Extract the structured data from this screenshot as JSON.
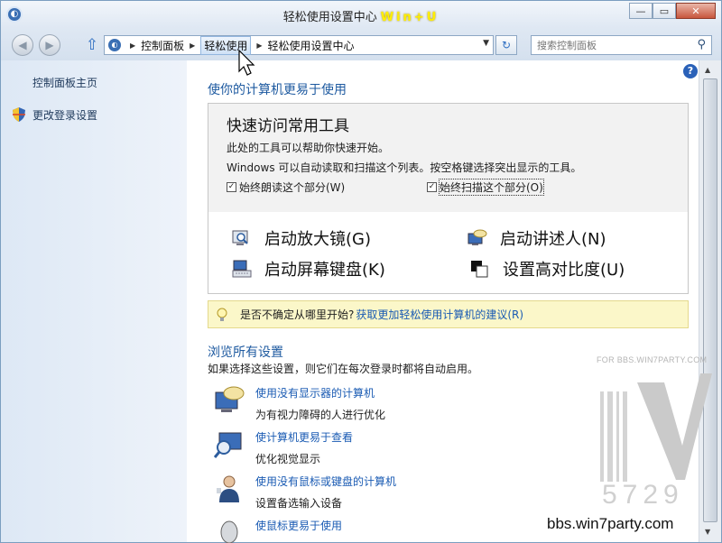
{
  "window": {
    "title": "轻松使用设置中心",
    "title_hint": "Win+U",
    "buttons": {
      "minimize": "—",
      "maximize": "▭",
      "close": "✕"
    }
  },
  "nav": {
    "back": "◀",
    "forward": "▶",
    "up": "⇧",
    "breadcrumbs": [
      "控制面板",
      "轻松使用",
      "轻松使用设置中心"
    ],
    "search_placeholder": "搜索控制面板",
    "refresh": "↻",
    "dropdown": "▼"
  },
  "sidebar": {
    "items": [
      {
        "label": "控制面板主页"
      },
      {
        "label": "更改登录设置",
        "icon": "shield-icon"
      }
    ]
  },
  "main": {
    "heading": "使你的计算机更易于使用",
    "quick": {
      "title": "快速访问常用工具",
      "line1": "此处的工具可以帮助你快速开始。",
      "line2": "Windows 可以自动读取和扫描这个列表。按空格键选择突出显示的工具。",
      "checkbox_read": "始终朗读这个部分(W)",
      "checkbox_scan": "始终扫描这个部分(O)",
      "checked_mark": "✓",
      "tools": [
        {
          "label": "启动放大镜(G)",
          "icon": "magnifier-icon"
        },
        {
          "label": "启动讲述人(N)",
          "icon": "narrator-icon"
        },
        {
          "label": "启动屏幕键盘(K)",
          "icon": "keyboard-icon"
        },
        {
          "label": "设置高对比度(U)",
          "icon": "contrast-icon"
        }
      ]
    },
    "tip": {
      "text": "是否不确定从哪里开始?",
      "link": "获取更加轻松使用计算机的建议(R)"
    },
    "browse": {
      "heading": "浏览所有设置",
      "desc": "如果选择这些设置，则它们在每次登录时都将自动启用。",
      "items": [
        {
          "title": "使用没有显示器的计算机",
          "desc": "为有视力障碍的人进行优化",
          "icon": "speech-monitor-icon"
        },
        {
          "title": "使计算机更易于查看",
          "desc": "优化视觉显示",
          "icon": "magnify-monitor-icon"
        },
        {
          "title": "使用没有鼠标或键盘的计算机",
          "desc": "设置备选输入设备",
          "icon": "person-icon"
        },
        {
          "title": "使鼠标更易于使用",
          "desc": "",
          "icon": "mouse-icon"
        }
      ]
    }
  },
  "watermark": {
    "text": "FOR BBS.WIN7PARTY.COM",
    "number": "5729",
    "site": "bbs.win7party.com"
  },
  "colors": {
    "link": "#1a5bb3",
    "heading": "#1e5aa0",
    "tip_bg": "#fbf7c9"
  }
}
